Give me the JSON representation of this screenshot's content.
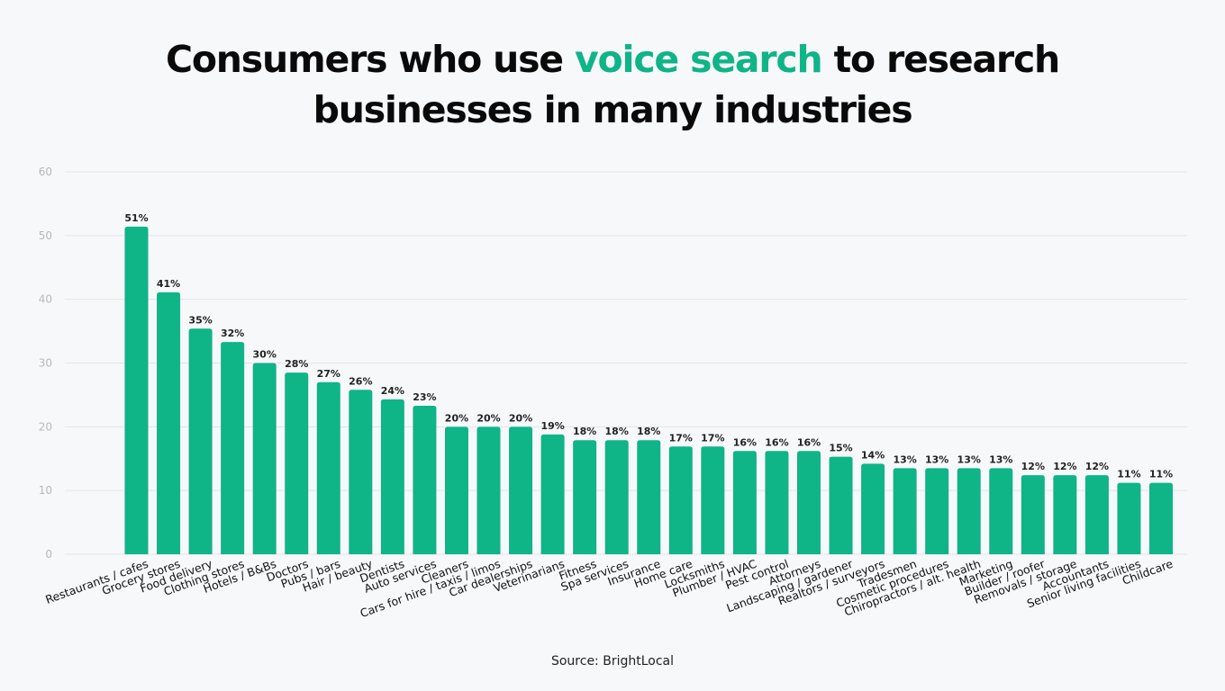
{
  "title": {
    "part1": "Consumers who use ",
    "highlight": "voice search",
    "part2": " to research",
    "line2": "businesses in many industries"
  },
  "colors": {
    "bar": "#0fb487",
    "highlight": "#0fb487",
    "grid": "#e2e4e8",
    "tick": "#b5b8bd",
    "label": "#222222"
  },
  "source": "Source: BrightLocal",
  "chart_data": {
    "type": "bar",
    "title": "Consumers who use voice search to research businesses in many industries",
    "xlabel": "",
    "ylabel": "",
    "ylim": [
      0,
      60
    ],
    "yticks": [
      0,
      10,
      20,
      30,
      40,
      50,
      60
    ],
    "grid": true,
    "legend": "none",
    "categories": [
      "Restaurants / cafes",
      "Grocery stores",
      "Food delivery",
      "Clothing stores",
      "Hotels / B&Bs",
      "Doctors",
      "Pubs / bars",
      "Hair / beauty",
      "Dentists",
      "Auto services",
      "Cleaners",
      "Cars for hire / taxis / limos",
      "Car dealerships",
      "Veterinarians",
      "Fitness",
      "Spa services",
      "Insurance",
      "Home care",
      "Locksmiths",
      "Plumber / HVAC",
      "Pest control",
      "Attorneys",
      "Landscaping / gardener",
      "Realtors / surveyors",
      "Tradesmen",
      "Cosmetic procedures",
      "Chiropractors / alt. health",
      "Marketing",
      "Builder / roofer",
      "Removals / storage",
      "Accountants",
      "Senior living facilities",
      "Childcare"
    ],
    "values": [
      51.4,
      41.1,
      35.4,
      33.3,
      30.0,
      28.5,
      27.0,
      25.8,
      24.3,
      23.3,
      20.0,
      20.0,
      20.0,
      18.8,
      17.9,
      17.9,
      17.9,
      16.9,
      16.9,
      16.2,
      16.2,
      16.2,
      15.3,
      14.2,
      13.5,
      13.5,
      13.5,
      13.5,
      12.4,
      12.4,
      12.4,
      11.2,
      11.2
    ],
    "data_labels": [
      "51%",
      "41%",
      "35%",
      "32%",
      "30%",
      "28%",
      "27%",
      "26%",
      "24%",
      "23%",
      "20%",
      "20%",
      "20%",
      "19%",
      "18%",
      "18%",
      "18%",
      "17%",
      "17%",
      "16%",
      "16%",
      "16%",
      "15%",
      "14%",
      "13%",
      "13%",
      "13%",
      "13%",
      "12%",
      "12%",
      "12%",
      "11%",
      "11%"
    ]
  }
}
